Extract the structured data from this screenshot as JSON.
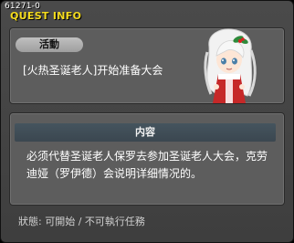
{
  "window": {
    "quest_id": "61271-0",
    "title": "QUEST INFO"
  },
  "quest": {
    "tag": "活動",
    "name": "[火热圣诞老人]开始准备大会"
  },
  "content": {
    "header": "内容",
    "text": "必须代替圣诞老人保罗去参加圣诞老人大会，克劳迪娅（罗伊德）会说明详细情况的。"
  },
  "status": {
    "text": "狀態: 可開始 / 不可執行任務"
  },
  "colors": {
    "title": "#f5dc1e",
    "window_bg": "#454545",
    "panel_bg": "#5d5d5d",
    "header_bg": "#3f4b54"
  },
  "icons": {
    "npc": "santa-girl-portrait"
  }
}
